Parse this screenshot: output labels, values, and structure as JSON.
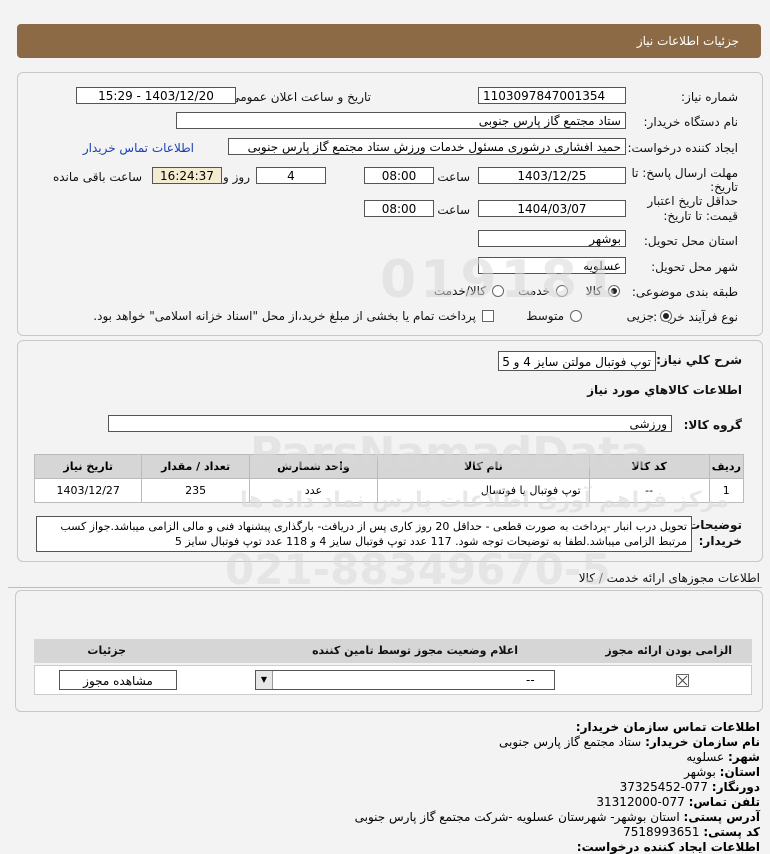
{
  "header": {
    "title": "جزئیات اطلاعات نیاز"
  },
  "need_info": {
    "need_number_label": "شماره نیاز:",
    "need_number": "1103097847001354",
    "announce_label": "تاریخ و ساعت اعلان عمومی:",
    "announce_value": "1403/12/20 - 15:29",
    "buyer_org_label": "نام دستگاه خریدار:",
    "buyer_org": "ستاد مجتمع گاز پارس جنوبی",
    "creator_label": "ایجاد کننده درخواست:",
    "creator": "حمید افشاری درشوری مسئول خدمات ورزش ستاد مجتمع گاز پارس جنوبی",
    "contact_link": "اطلاعات تماس خریدار",
    "deadline_label_1": "مهلت ارسال پاسخ: تا",
    "deadline_label_2": "تاریخ:",
    "deadline_date": "1403/12/25",
    "time_label": "ساعت",
    "deadline_time": "08:00",
    "days_value": "4",
    "days_label": "روز و",
    "remaining_time": "16:24:37",
    "remaining_label": "ساعت باقی مانده",
    "validity_label_1": "حداقل تاریخ اعتبار",
    "validity_label_2": "قیمت: تا تاریخ:",
    "validity_date": "1404/03/07",
    "validity_time": "08:00",
    "province_label": "استان محل تحویل:",
    "province": "بوشهر",
    "city_label": "شهر محل تحویل:",
    "city": "عسلویه",
    "category_label": "طبقه بندی موضوعی:",
    "category_options": [
      "کالا",
      "خدمت",
      "کالا/خدمت"
    ],
    "category_selected": "کالا",
    "process_label": "نوع فرآیند خرید :",
    "process_options": [
      "جزیی",
      "متوسط"
    ],
    "process_selected": "جزیی",
    "payment_note": "پرداخت تمام یا بخشی از مبلغ خرید،از محل \"اسناد خزانه اسلامی\" خواهد بود."
  },
  "description": {
    "summary_label": "شرح كلي نياز:",
    "summary": "توپ فوتبال مولتن سایز 4 و 5",
    "goods_heading": "اطلاعات كالاهاي مورد نياز",
    "group_label": "گروه کالا:",
    "group_value": "ورزشی"
  },
  "goods_table": {
    "headers": [
      "ردیف",
      "کد کالا",
      "نام کالا",
      "واحد شمارش",
      "تعداد / مقدار",
      "تاریخ نیاز"
    ],
    "rows": [
      {
        "row": "1",
        "code": "--",
        "name": "توپ فوتبال یا فوتسال",
        "unit": "عدد",
        "qty": "235",
        "date": "1403/12/27"
      }
    ]
  },
  "buyer_notes": {
    "label_1": "توضیحات",
    "label_2": "خریدار:",
    "text": "تحویل درب انبار -پرداخت به صورت قطعی - حداقل 20 روز کاری پس از دریافت- بارگذاری پیشنهاد فنی و مالی الزامی میباشد.جواز کسب مرتبط الزامی میباشد.لطفا به توضیحات توجه شود. 117 عدد توپ فوتبال سایز 4 و 118 عدد توپ فوتبال سایز 5"
  },
  "licenses": {
    "heading": "اطلاعات مجوزهای ارائه خدمت / کالا",
    "headers": [
      "الزامی بودن ارائه مجوز",
      "اعلام وضعیت مجوز توسط تامین کننده",
      "جزئیات"
    ],
    "select_value": "--",
    "view_button": "مشاهده مجوز"
  },
  "buyer_contact": {
    "heading": "اطلاعات تماس سازمان خریدار:",
    "org_label": "نام سازمان خریدار:",
    "org": "ستاد مجتمع گاز پارس جنوبی",
    "city_label": "شهر:",
    "city": "عسلویه",
    "province_label": "استان:",
    "province": "بوشهر",
    "fax_label": "دورنگار:",
    "fax": "077-37325452",
    "phone_label": "تلفن تماس:",
    "phone": "077-31312000",
    "address_label": "آدرس پستی:",
    "address": "استان بوشهر- شهرستان عسلویه -شرکت مجتمع گاز پارس جنوبی",
    "postal_label": "کد پستی:",
    "postal": "7518993651",
    "creator_label": "اطلاعات ایجاد کننده درخواست:"
  },
  "watermark": {
    "line1": "ParsNamadData",
    "line2": "مرکز فراهم آوری اطلاعات پارس نماد داده ها",
    "phone": "021-88349670-5",
    "numbers": "019181"
  }
}
